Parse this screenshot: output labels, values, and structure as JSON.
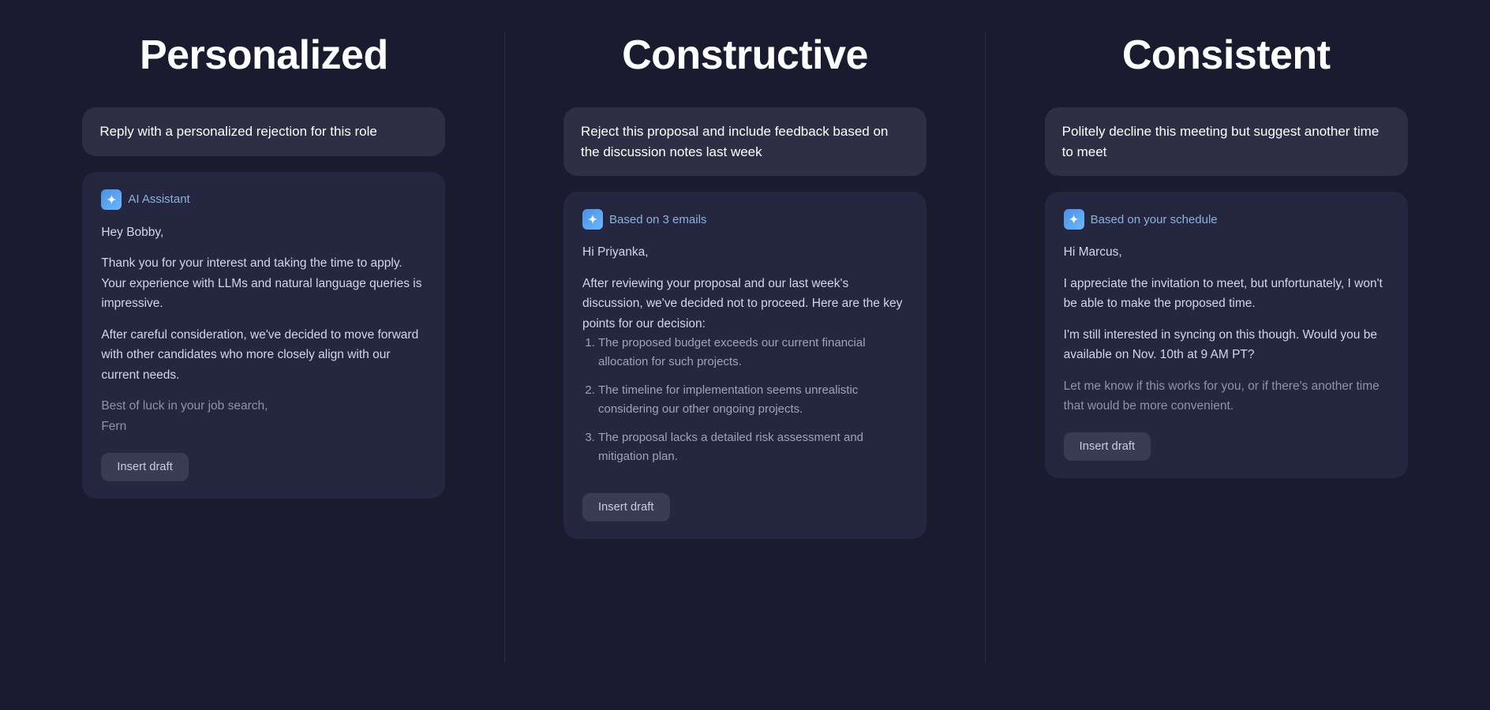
{
  "columns": [
    {
      "id": "personalized",
      "title": "Personalized",
      "prompt": "Reply with a personalized rejection for this role",
      "header_icon": "✦",
      "header_label": "AI Assistant",
      "body_paragraphs": [
        "Hey Bobby,",
        "Thank you for your interest and taking the time to apply. Your experience with LLMs and natural language queries is impressive.",
        "After careful consideration, we've decided to move forward with other candidates who more closely align with our current needs.",
        "Best of luck in your job search,\nFern"
      ],
      "list_items": [],
      "button_label": "Insert draft"
    },
    {
      "id": "constructive",
      "title": "Constructive",
      "prompt": "Reject this proposal and include feedback based on the discussion notes last week",
      "header_icon": "✦",
      "header_label": "Based on 3 emails",
      "body_paragraphs": [
        "Hi Priyanka,",
        "After reviewing your proposal and our last week's discussion, we've decided not to proceed. Here are the key points for our decision:"
      ],
      "list_items": [
        "The proposed budget exceeds our current financial allocation for such projects.",
        "The timeline for implementation seems unrealistic considering our other ongoing projects.",
        "The proposal lacks a detailed risk assessment and mitigation plan."
      ],
      "button_label": "Insert draft"
    },
    {
      "id": "consistent",
      "title": "Consistent",
      "prompt": "Politely decline this meeting but suggest another time to meet",
      "header_icon": "✦",
      "header_label": "Based on your schedule",
      "body_paragraphs": [
        "Hi Marcus,",
        "I appreciate the invitation to meet, but unfortunately, I won't be able to make the proposed time.",
        "I'm still interested in syncing on this though. Would you be available on Nov. 10th at 9 AM PT?",
        "Let me know if this works for you, or if there's another time that would be more convenient."
      ],
      "list_items": [],
      "button_label": "Insert draft"
    }
  ]
}
